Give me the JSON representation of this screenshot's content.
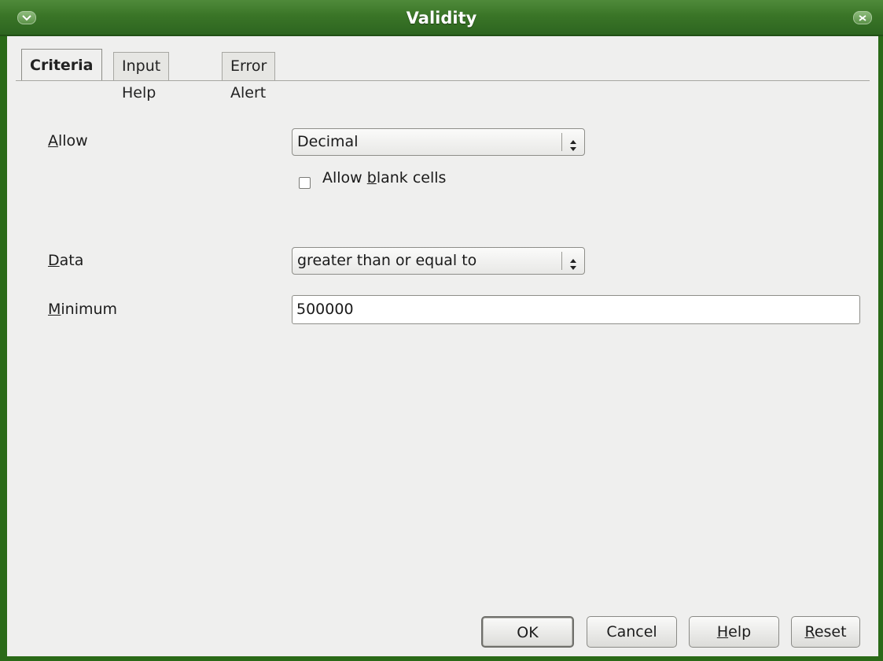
{
  "window": {
    "title": "Validity",
    "menu_icon": "chevron-down-icon",
    "close_icon": "close-icon",
    "accent_color": "#3a7527"
  },
  "tabs": [
    {
      "label": "Criteria",
      "active": true
    },
    {
      "label": "Input Help",
      "active": false
    },
    {
      "label": "Error Alert",
      "active": false
    }
  ],
  "criteria": {
    "allow": {
      "mnemonic": "A",
      "label_rest": "llow",
      "value": "Decimal"
    },
    "allow_blank": {
      "before": "Allow ",
      "mnemonic": "b",
      "after": "lank cells",
      "checked": false
    },
    "data": {
      "mnemonic": "D",
      "label_rest": "ata",
      "value": "greater than or equal to"
    },
    "minimum": {
      "mnemonic": "M",
      "label_rest": "inimum",
      "value": "500000"
    }
  },
  "buttons": {
    "ok": "OK",
    "cancel": "Cancel",
    "help_mnemonic": "H",
    "help_rest": "elp",
    "reset_mnemonic": "R",
    "reset_rest": "eset"
  }
}
